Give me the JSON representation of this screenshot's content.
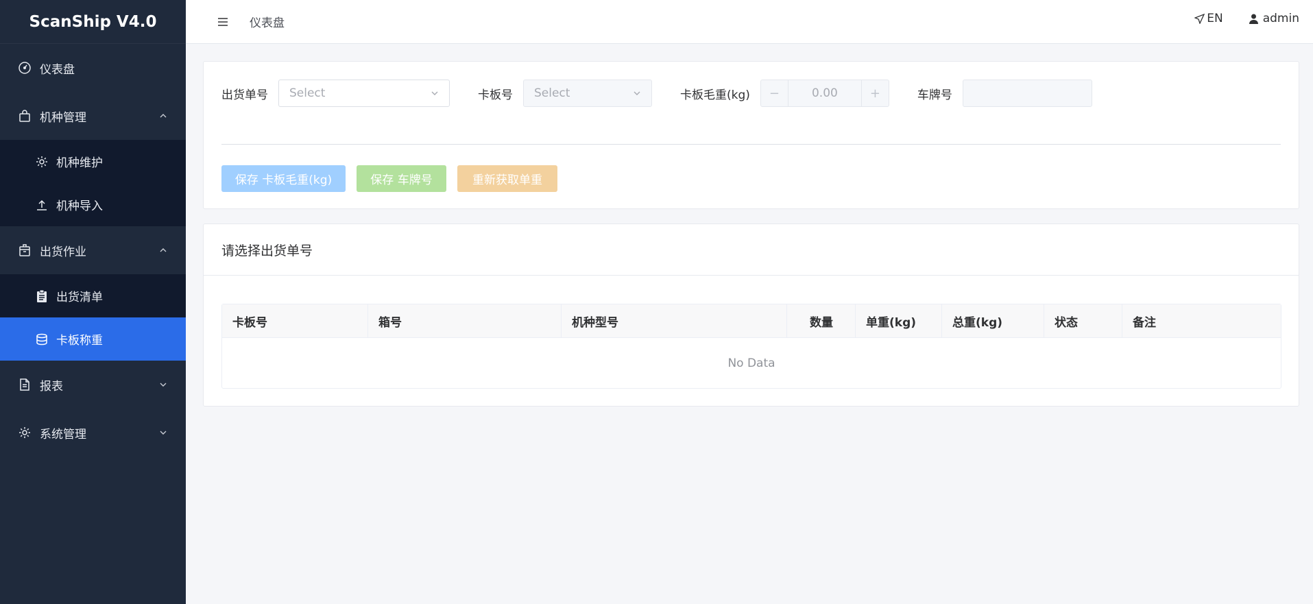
{
  "app": {
    "title": "ScanShip V4.0"
  },
  "sidebar": {
    "items": [
      {
        "label": "仪表盘",
        "icon": "dashboard-icon"
      },
      {
        "label": "机种管理",
        "icon": "bag-icon",
        "expanded": true,
        "children": [
          {
            "label": "机种维护",
            "icon": "gear-icon"
          },
          {
            "label": "机种导入",
            "icon": "upload-icon"
          }
        ]
      },
      {
        "label": "出货作业",
        "icon": "package-icon",
        "expanded": true,
        "children": [
          {
            "label": "出货清单",
            "icon": "clipboard-icon"
          },
          {
            "label": "卡板称重",
            "icon": "database-icon",
            "active": true
          }
        ]
      },
      {
        "label": "报表",
        "icon": "document-icon",
        "expanded": false
      },
      {
        "label": "系统管理",
        "icon": "gear-icon",
        "expanded": false
      }
    ]
  },
  "header": {
    "breadcrumb": "仪表盘",
    "lang": "EN",
    "user": "admin"
  },
  "form": {
    "order_label": "出货单号",
    "order_placeholder": "Select",
    "pallet_label": "卡板号",
    "pallet_placeholder": "Select",
    "weight_label": "卡板毛重(kg)",
    "weight_value": "0.00",
    "minus": "−",
    "plus": "+",
    "plate_label": "车牌号",
    "plate_value": ""
  },
  "actions": {
    "save_weight": "保存 卡板毛重(kg)",
    "save_plate": "保存 车牌号",
    "refetch": "重新获取单重"
  },
  "section": {
    "title": "请选择出货单号"
  },
  "table": {
    "columns": [
      "卡板号",
      "箱号",
      "机种型号",
      "数量",
      "单重(kg)",
      "总重(kg)",
      "状态",
      "备注"
    ],
    "empty_text": "No Data"
  },
  "colors": {
    "sidebar_bg": "#1f2a3c",
    "submenu_bg": "#111a2d",
    "active_bg": "#2b6ce8",
    "btn_primary": "#a0cfff",
    "btn_success": "#b3e19d",
    "btn_warning": "#f3d19e"
  }
}
